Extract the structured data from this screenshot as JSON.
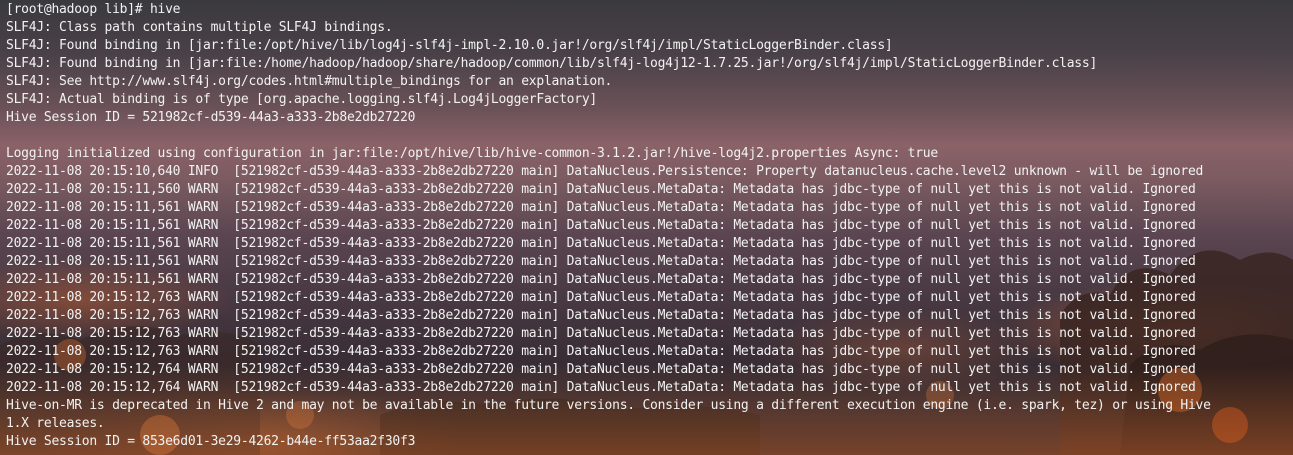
{
  "terminal": {
    "lines": [
      "[root@hadoop lib]# hive",
      "SLF4J: Class path contains multiple SLF4J bindings.",
      "SLF4J: Found binding in [jar:file:/opt/hive/lib/log4j-slf4j-impl-2.10.0.jar!/org/slf4j/impl/StaticLoggerBinder.class]",
      "SLF4J: Found binding in [jar:file:/home/hadoop/hadoop/share/hadoop/common/lib/slf4j-log4j12-1.7.25.jar!/org/slf4j/impl/StaticLoggerBinder.class]",
      "SLF4J: See http://www.slf4j.org/codes.html#multiple_bindings for an explanation.",
      "SLF4J: Actual binding is of type [org.apache.logging.slf4j.Log4jLoggerFactory]",
      "Hive Session ID = 521982cf-d539-44a3-a333-2b8e2db27220",
      "",
      "Logging initialized using configuration in jar:file:/opt/hive/lib/hive-common-3.1.2.jar!/hive-log4j2.properties Async: true",
      "2022-11-08 20:15:10,640 INFO  [521982cf-d539-44a3-a333-2b8e2db27220 main] DataNucleus.Persistence: Property datanucleus.cache.level2 unknown - will be ignored",
      "2022-11-08 20:15:11,560 WARN  [521982cf-d539-44a3-a333-2b8e2db27220 main] DataNucleus.MetaData: Metadata has jdbc-type of null yet this is not valid. Ignored",
      "2022-11-08 20:15:11,561 WARN  [521982cf-d539-44a3-a333-2b8e2db27220 main] DataNucleus.MetaData: Metadata has jdbc-type of null yet this is not valid. Ignored",
      "2022-11-08 20:15:11,561 WARN  [521982cf-d539-44a3-a333-2b8e2db27220 main] DataNucleus.MetaData: Metadata has jdbc-type of null yet this is not valid. Ignored",
      "2022-11-08 20:15:11,561 WARN  [521982cf-d539-44a3-a333-2b8e2db27220 main] DataNucleus.MetaData: Metadata has jdbc-type of null yet this is not valid. Ignored",
      "2022-11-08 20:15:11,561 WARN  [521982cf-d539-44a3-a333-2b8e2db27220 main] DataNucleus.MetaData: Metadata has jdbc-type of null yet this is not valid. Ignored",
      "2022-11-08 20:15:11,561 WARN  [521982cf-d539-44a3-a333-2b8e2db27220 main] DataNucleus.MetaData: Metadata has jdbc-type of null yet this is not valid. Ignored",
      "2022-11-08 20:15:12,763 WARN  [521982cf-d539-44a3-a333-2b8e2db27220 main] DataNucleus.MetaData: Metadata has jdbc-type of null yet this is not valid. Ignored",
      "2022-11-08 20:15:12,763 WARN  [521982cf-d539-44a3-a333-2b8e2db27220 main] DataNucleus.MetaData: Metadata has jdbc-type of null yet this is not valid. Ignored",
      "2022-11-08 20:15:12,763 WARN  [521982cf-d539-44a3-a333-2b8e2db27220 main] DataNucleus.MetaData: Metadata has jdbc-type of null yet this is not valid. Ignored",
      "2022-11-08 20:15:12,763 WARN  [521982cf-d539-44a3-a333-2b8e2db27220 main] DataNucleus.MetaData: Metadata has jdbc-type of null yet this is not valid. Ignored",
      "2022-11-08 20:15:12,764 WARN  [521982cf-d539-44a3-a333-2b8e2db27220 main] DataNucleus.MetaData: Metadata has jdbc-type of null yet this is not valid. Ignored",
      "2022-11-08 20:15:12,764 WARN  [521982cf-d539-44a3-a333-2b8e2db27220 main] DataNucleus.MetaData: Metadata has jdbc-type of null yet this is not valid. Ignored",
      "Hive-on-MR is deprecated in Hive 2 and may not be available in the future versions. Consider using a different execution engine (i.e. spark, tez) or using Hive",
      "1.X releases.",
      "Hive Session ID = 853e6d01-3e29-4262-b44e-ff53aa2f30f3"
    ]
  },
  "colors": {
    "text": "#f2f2f2"
  }
}
